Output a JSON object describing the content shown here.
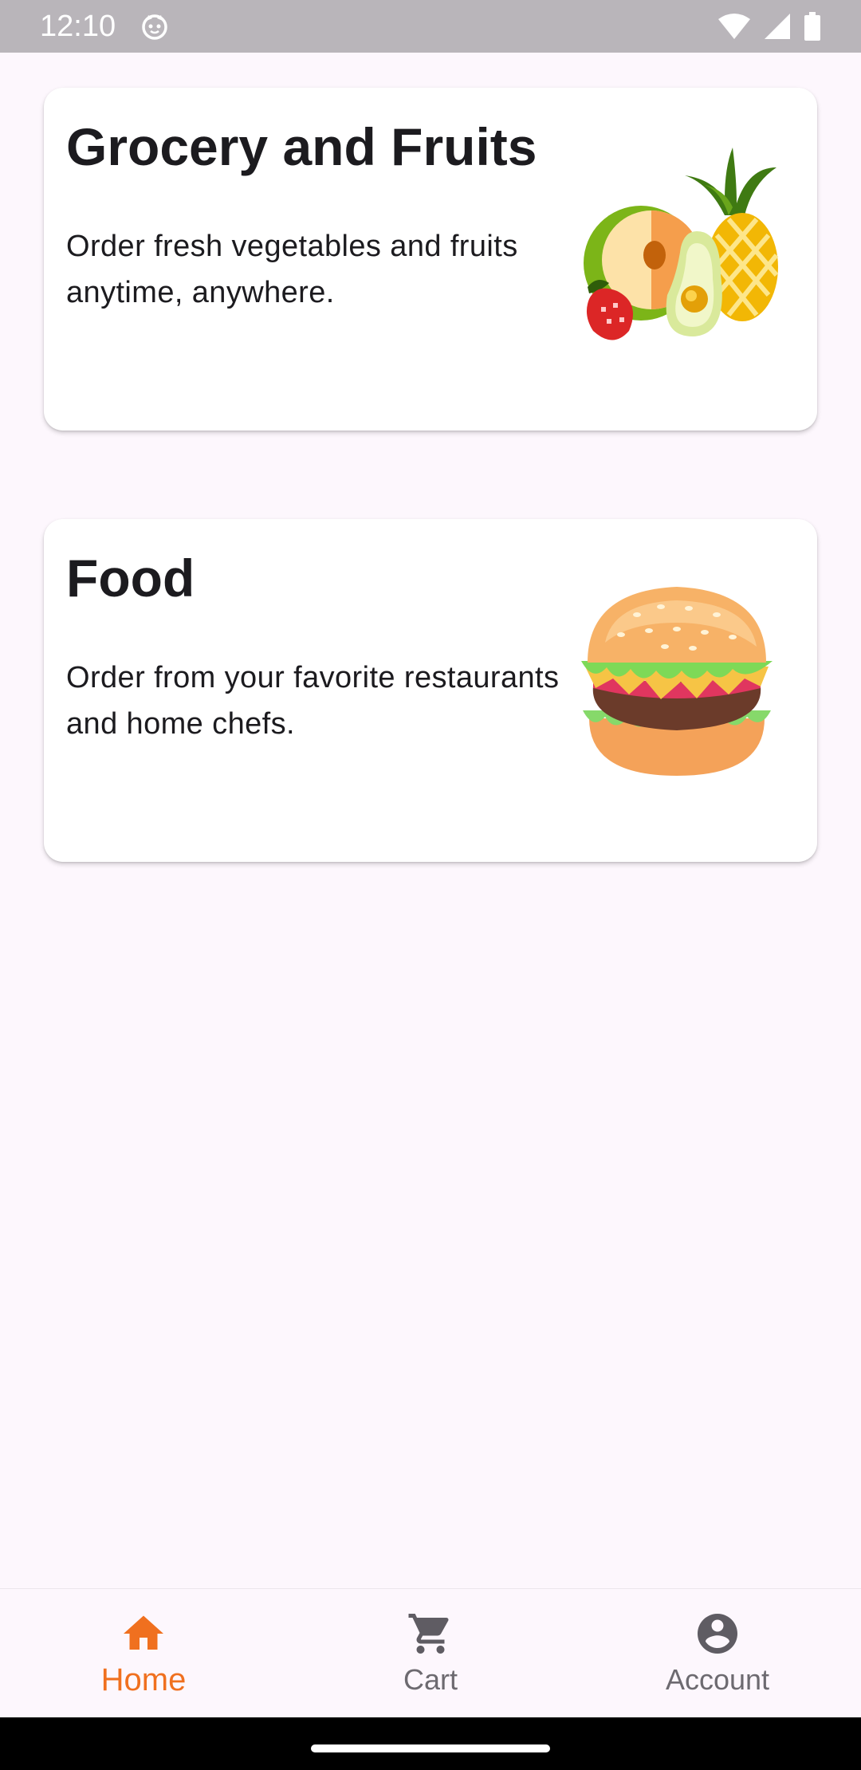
{
  "status_bar": {
    "time": "12:10",
    "left_icon": "cat-face-icon",
    "right_icons": [
      "wifi-icon",
      "cellular-signal-icon",
      "battery-icon"
    ]
  },
  "cards": [
    {
      "title": "Grocery and Fruits",
      "description": "Order fresh vegetables and fruits anytime, anywhere.",
      "image": "fruits-illustration"
    },
    {
      "title": "Food",
      "description": "Order from your favorite restaurants and home chefs.",
      "image": "burger-illustration"
    }
  ],
  "bottom_nav": {
    "items": [
      {
        "label": "Home",
        "icon": "home-icon",
        "active": true
      },
      {
        "label": "Cart",
        "icon": "cart-icon",
        "active": false
      },
      {
        "label": "Account",
        "icon": "account-circle-icon",
        "active": false
      }
    ]
  },
  "colors": {
    "accent": "#f0701f",
    "background": "#fdf7fd",
    "card": "#ffffff",
    "inactive": "#6d6a70"
  }
}
